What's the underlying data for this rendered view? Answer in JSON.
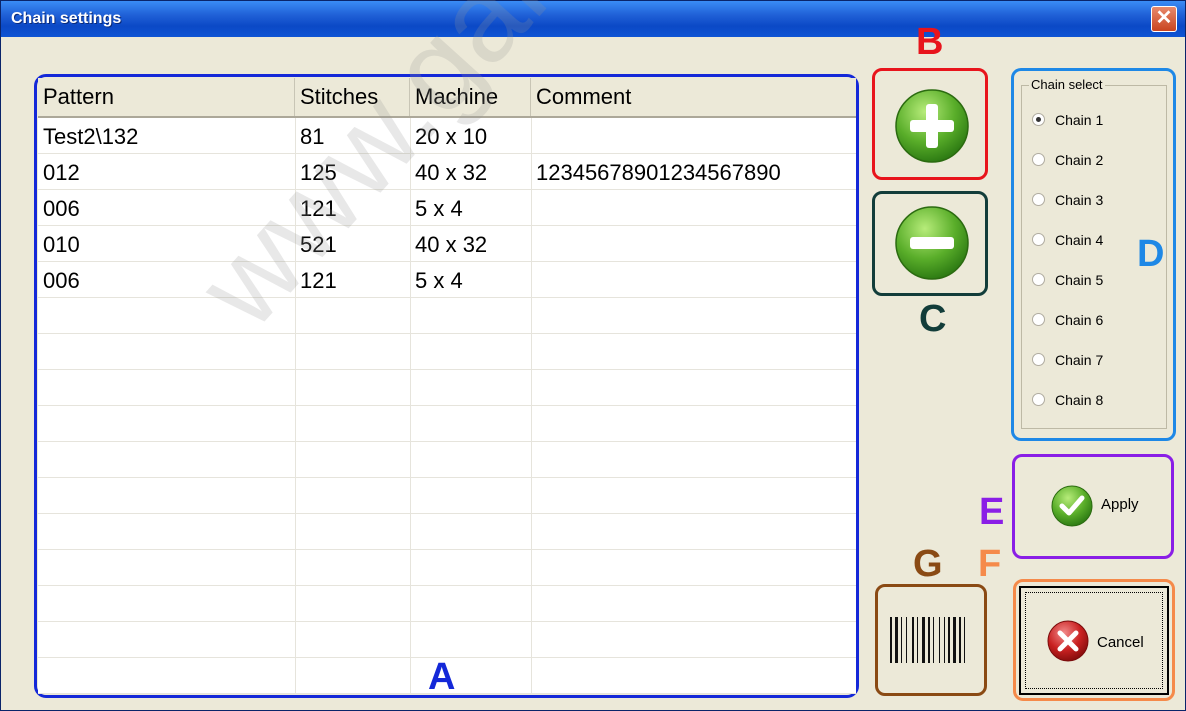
{
  "window": {
    "title": "Chain settings",
    "close_symbol": "✕"
  },
  "table": {
    "columns": [
      "Pattern",
      "Stitches",
      "Machine",
      "Comment"
    ],
    "rows": [
      [
        "Test2\\132",
        "81",
        "20 x 10",
        ""
      ],
      [
        "012",
        "125",
        "40 x 32",
        "12345678901234567890"
      ],
      [
        "006",
        "121",
        "5 x 4",
        ""
      ],
      [
        "010",
        "521",
        "40 x 32",
        ""
      ],
      [
        "006",
        "121",
        "5 x 4",
        ""
      ]
    ]
  },
  "chain_select": {
    "label": "Chain select",
    "options": [
      "Chain 1",
      "Chain 2",
      "Chain 3",
      "Chain 4",
      "Chain 5",
      "Chain 6",
      "Chain 7",
      "Chain 8"
    ],
    "selected": "Chain 1"
  },
  "buttons": {
    "apply": "Apply",
    "cancel": "Cancel"
  },
  "callouts": {
    "a": "A",
    "b": "B",
    "c": "C",
    "d": "D",
    "e": "E",
    "f": "F",
    "g": "G"
  },
  "watermark": "www.garuda",
  "colors": {
    "a": "#1428d8",
    "b": "#e8141c",
    "c": "#123d3a",
    "d": "#1e88e6",
    "e": "#8a1ee6",
    "f": "#f58a4a",
    "g": "#8a4a14"
  }
}
